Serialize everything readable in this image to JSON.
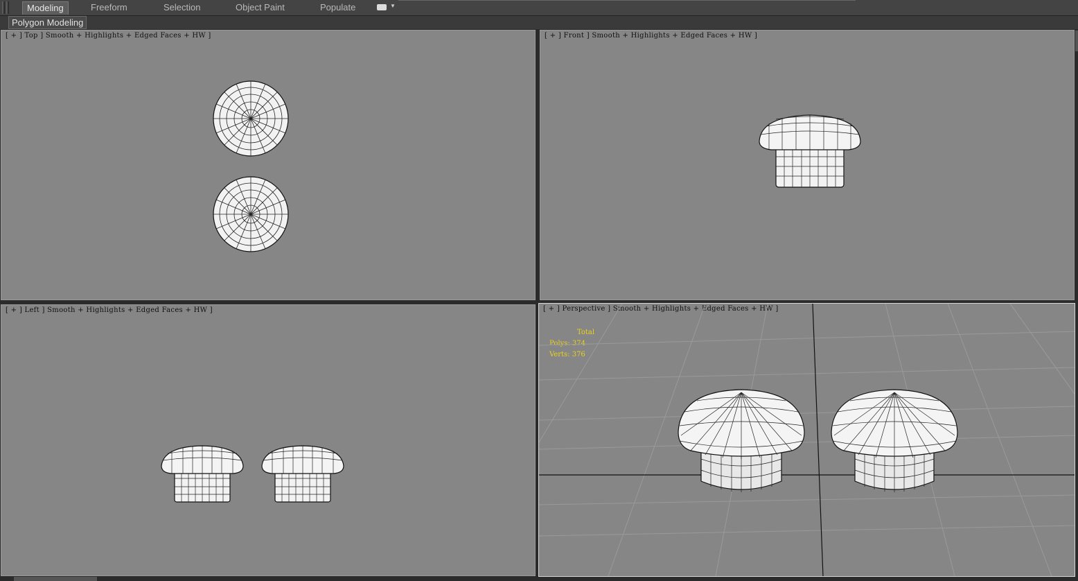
{
  "ribbon": {
    "tabs": [
      {
        "label": "Modeling",
        "active": true
      },
      {
        "label": "Freeform",
        "active": false
      },
      {
        "label": "Selection",
        "active": false
      },
      {
        "label": "Object Paint",
        "active": false
      },
      {
        "label": "Populate",
        "active": false
      }
    ],
    "menu_icon": "ribbon-options-icon"
  },
  "panel": {
    "label": "Polygon Modeling"
  },
  "viewports": {
    "top": {
      "label": "[ + ] Top ] Smooth + Highlights + Edged Faces + HW ]"
    },
    "front": {
      "label": "[ + ] Front ] Smooth + Highlights + Edged Faces + HW ]"
    },
    "left": {
      "label": "[ + ] Left ] Smooth + Highlights + Edged Faces + HW ]"
    },
    "perspective": {
      "label": "[ + ] Perspective ] Smooth + Highlights + Edged Faces + HW ]",
      "stats": {
        "title": "Total",
        "polys": "Polys: 374",
        "verts": "Verts: 376"
      }
    }
  },
  "colors": {
    "viewport_bg": "#868686",
    "stats_text": "#e8d21e",
    "mesh_fill": "#f4f4f4",
    "mesh_line": "#111111"
  }
}
